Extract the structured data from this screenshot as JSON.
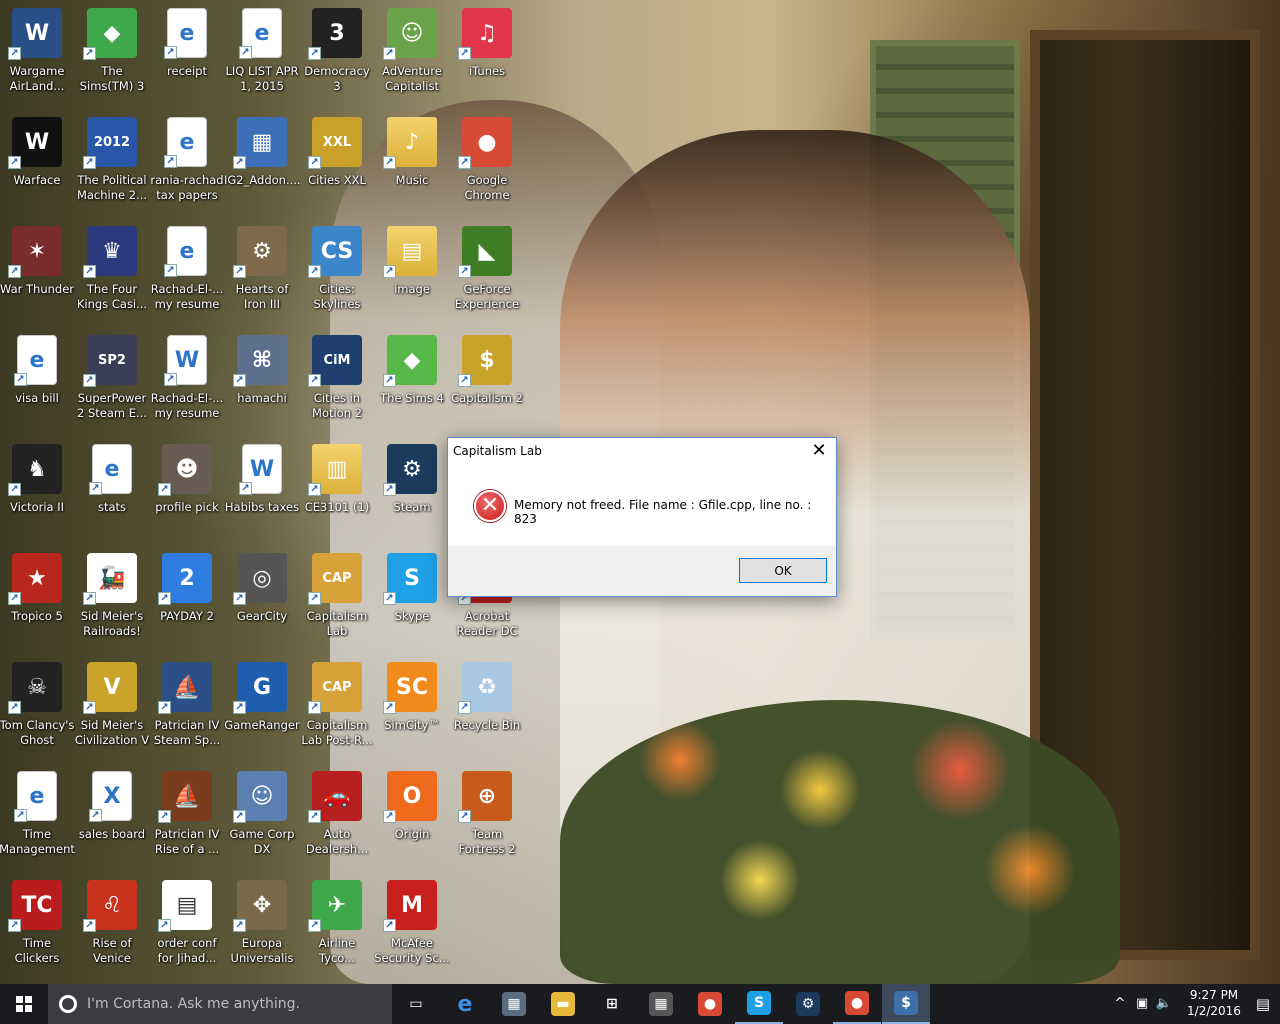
{
  "desktop": {
    "icons": [
      {
        "label": "Wargame\nAirLand...",
        "glyph": "W",
        "color": "#2a4f86",
        "icon": "wargame-icon"
      },
      {
        "label": "The\nSims(TM) 3",
        "glyph": "◆",
        "color": "#3fa84a",
        "icon": "plumbob-icon"
      },
      {
        "label": "receipt",
        "glyph": "e",
        "kind": "doc",
        "icon": "pdf-icon"
      },
      {
        "label": "LIQ LIST APR\n1, 2015",
        "glyph": "e",
        "kind": "doc",
        "icon": "pdf-icon"
      },
      {
        "label": "Democracy 3",
        "glyph": "3",
        "color": "#222222",
        "icon": "democracy-icon"
      },
      {
        "label": "AdVenture\nCapitalist",
        "glyph": "☺",
        "color": "#6aa34a",
        "icon": "adventure-capitalist-icon"
      },
      {
        "label": "iTunes",
        "glyph": "♫",
        "color": "#e2364b",
        "icon": "itunes-icon"
      },
      {
        "label": "Warface",
        "glyph": "W",
        "color": "#111111",
        "icon": "warface-icon"
      },
      {
        "label": "The Political\nMachine 2...",
        "glyph": "2012",
        "color": "#2a56a8",
        "icon": "political-machine-icon"
      },
      {
        "label": "rania-rachad\ntax papers",
        "glyph": "e",
        "kind": "doc",
        "icon": "pdf-icon"
      },
      {
        "label": "IG2_Addon....",
        "glyph": "▦",
        "color": "#3c6fb8",
        "icon": "installer-icon"
      },
      {
        "label": "Cities XXL",
        "glyph": "XXL",
        "color": "#c9a02a",
        "icon": "cities-xxl-icon"
      },
      {
        "label": "Music",
        "glyph": "♪",
        "kind": "folder",
        "icon": "music-folder-icon"
      },
      {
        "label": "Google\nChrome",
        "glyph": "●",
        "color": "#d84a35",
        "icon": "chrome-icon"
      },
      {
        "label": "War Thunder",
        "glyph": "✶",
        "color": "#7a2c2c",
        "icon": "war-thunder-icon"
      },
      {
        "label": "The Four\nKings Casi...",
        "glyph": "♛",
        "color": "#2b3a7c",
        "icon": "four-kings-icon"
      },
      {
        "label": "Rachad-El-...\nmy resume",
        "glyph": "e",
        "kind": "doc",
        "icon": "pdf-icon"
      },
      {
        "label": "Hearts of\nIron III",
        "glyph": "⚙",
        "color": "#7e6a4a",
        "icon": "hearts-of-iron-icon"
      },
      {
        "label": "Cities:\nSkylines",
        "glyph": "CS",
        "color": "#3a86c8",
        "icon": "cities-skylines-icon"
      },
      {
        "label": "image",
        "glyph": "▤",
        "kind": "folder",
        "icon": "image-folder-icon"
      },
      {
        "label": "GeForce\nExperience",
        "glyph": "◣",
        "color": "#3f7d24",
        "icon": "geforce-icon"
      },
      {
        "label": "visa bill",
        "glyph": "e",
        "kind": "doc",
        "icon": "pdf-icon"
      },
      {
        "label": "SuperPower\n2 Steam E...",
        "glyph": "SP2",
        "color": "#3a3f55",
        "icon": "superpower-icon"
      },
      {
        "label": "Rachad-El-...\nmy resume",
        "glyph": "W",
        "kind": "doc",
        "icon": "word-doc-icon"
      },
      {
        "label": "hamachi",
        "glyph": "⌘",
        "color": "#5c6f8c",
        "icon": "hamachi-icon"
      },
      {
        "label": "Cities in\nMotion 2",
        "glyph": "CiM",
        "color": "#1d3e6e",
        "icon": "cities-in-motion-icon"
      },
      {
        "label": "The Sims 4",
        "glyph": "◆",
        "color": "#55b848",
        "icon": "plumbob-icon"
      },
      {
        "label": "Capitalism 2",
        "glyph": "$",
        "color": "#c9a22a",
        "icon": "capitalism-icon"
      },
      {
        "label": "Victoria II",
        "glyph": "♞",
        "color": "#222222",
        "icon": "victoria-icon"
      },
      {
        "label": "stats",
        "glyph": "e",
        "kind": "doc",
        "icon": "pdf-icon"
      },
      {
        "label": "profile pick",
        "glyph": "☻",
        "color": "#6a5b52",
        "icon": "photo-icon"
      },
      {
        "label": "Habibs taxes",
        "glyph": "W",
        "kind": "doc",
        "icon": "word-doc-icon"
      },
      {
        "label": "CE3101 (1)",
        "glyph": "▥",
        "kind": "folder",
        "icon": "zip-folder-icon"
      },
      {
        "label": "Steam",
        "glyph": "⚙",
        "color": "#1b3b5c",
        "icon": "steam-icon"
      },
      {
        "label": "",
        "glyph": "",
        "color": "transparent",
        "icon": "hidden-icon"
      },
      {
        "label": "Tropico 5",
        "glyph": "★",
        "color": "#b8261c",
        "icon": "tropico-icon"
      },
      {
        "label": "Sid Meier's\nRailroads!",
        "glyph": "🚂",
        "color": "#ffffff",
        "icon": "railroads-icon"
      },
      {
        "label": "PAYDAY 2",
        "glyph": "2",
        "color": "#2f7de0",
        "icon": "payday-icon"
      },
      {
        "label": "GearCity",
        "glyph": "◎",
        "color": "#555555",
        "icon": "gearcity-icon"
      },
      {
        "label": "Capitalism\nLab",
        "glyph": "CAP",
        "color": "#d8a23a",
        "icon": "capitalism-lab-icon"
      },
      {
        "label": "Skype",
        "glyph": "S",
        "color": "#1fa0e6",
        "icon": "skype-icon"
      },
      {
        "label": "Acrobat\nReader DC",
        "glyph": "A",
        "color": "#c8201c",
        "icon": "acrobat-icon"
      },
      {
        "label": "Tom Clancy's\nGhost Reco...",
        "glyph": "☠",
        "color": "#222222",
        "icon": "ghost-recon-icon"
      },
      {
        "label": "Sid Meier's\nCivilization V",
        "glyph": "V",
        "color": "#c9a22a",
        "icon": "civilization-icon"
      },
      {
        "label": "Patrician IV\nSteam Sp...",
        "glyph": "⛵",
        "color": "#2c4f87",
        "icon": "patrician-icon"
      },
      {
        "label": "GameRanger",
        "glyph": "G",
        "color": "#1d5fae",
        "icon": "gameranger-icon"
      },
      {
        "label": "Capitalism\nLab Post-R...",
        "glyph": "CAP",
        "color": "#d8a23a",
        "icon": "capitalism-lab-icon"
      },
      {
        "label": "SimCity™",
        "glyph": "SC",
        "color": "#f08a1a",
        "icon": "simcity-icon"
      },
      {
        "label": "Recycle Bin",
        "glyph": "♻",
        "color": "#a9c8e4",
        "icon": "recycle-bin-icon"
      },
      {
        "label": "Time\nManagement",
        "glyph": "e",
        "kind": "doc",
        "icon": "pdf-icon"
      },
      {
        "label": "sales board",
        "glyph": "X",
        "kind": "doc",
        "icon": "excel-doc-icon"
      },
      {
        "label": "Patrician IV\nRise of a ...",
        "glyph": "⛵",
        "color": "#7a3c1c",
        "icon": "patrician-icon"
      },
      {
        "label": "Game Corp\nDX",
        "glyph": "☺",
        "color": "#5a7fb0",
        "icon": "game-corp-icon"
      },
      {
        "label": "Auto\nDealersh...",
        "glyph": "🚗",
        "color": "#b82020",
        "icon": "auto-dealership-icon"
      },
      {
        "label": "Origin",
        "glyph": "O",
        "color": "#f06a1e",
        "icon": "origin-icon"
      },
      {
        "label": "Team\nFortress 2",
        "glyph": "⊕",
        "color": "#c85a1c",
        "icon": "team-fortress-icon"
      },
      {
        "label": "Time Clickers",
        "glyph": "TC",
        "color": "#b81c1c",
        "icon": "time-clickers-icon"
      },
      {
        "label": "Rise of\nVenice",
        "glyph": "♌",
        "color": "#c8321c",
        "icon": "rise-of-venice-icon"
      },
      {
        "label": "order conf\nfor Jihad...",
        "glyph": "▤",
        "color": "#ffffff",
        "icon": "document-icon"
      },
      {
        "label": "Europa\nUniversalis IV",
        "glyph": "✥",
        "color": "#7a6a4a",
        "icon": "europa-icon"
      },
      {
        "label": "Airline\nTyco...",
        "glyph": "✈",
        "color": "#3fa84a",
        "icon": "airline-tycoon-icon"
      },
      {
        "label": "McAfee\nSecurity Sc...",
        "glyph": "M",
        "color": "#c8201c",
        "icon": "mcafee-icon"
      },
      {
        "label": "",
        "glyph": "",
        "color": "transparent",
        "icon": "hidden-icon"
      }
    ]
  },
  "dialog": {
    "title": "Capitalism Lab",
    "close_glyph": "✕",
    "error_glyph": "✕",
    "message": "Memory not freed. File name : Gfile.cpp, line no. : 823",
    "ok_label": "OK"
  },
  "taskbar": {
    "cortana_placeholder": "I'm Cortana. Ask me anything.",
    "apps": [
      {
        "icon": "task-view-icon",
        "glyph": "▭",
        "color": "transparent",
        "state": ""
      },
      {
        "icon": "edge-icon",
        "glyph": "e",
        "color": "transparent",
        "state": ""
      },
      {
        "icon": "network-icon",
        "glyph": "▦",
        "color": "#5a6c80",
        "state": ""
      },
      {
        "icon": "file-explorer-icon",
        "glyph": "▬",
        "color": "#e8b83a",
        "state": ""
      },
      {
        "icon": "store-icon",
        "glyph": "⊞",
        "color": "transparent",
        "state": ""
      },
      {
        "icon": "calculator-icon",
        "glyph": "▦",
        "color": "#555555",
        "state": ""
      },
      {
        "icon": "chrome-icon",
        "glyph": "●",
        "color": "#d84a35",
        "state": ""
      },
      {
        "icon": "skype-icon",
        "glyph": "S",
        "color": "#1fa0e6",
        "state": "running"
      },
      {
        "icon": "steam-icon",
        "glyph": "⚙",
        "color": "#1b3b5c",
        "state": ""
      },
      {
        "icon": "chrome-icon",
        "glyph": "●",
        "color": "#d84a35",
        "state": "running"
      },
      {
        "icon": "capitalism-lab-icon",
        "glyph": "$",
        "color": "#3d6fa8",
        "state": "active"
      }
    ],
    "tray": {
      "chevron": "^",
      "network": "▣",
      "volume": "🔈",
      "time": "9:27 PM",
      "date": "1/2/2016",
      "notifications": "▤"
    }
  }
}
